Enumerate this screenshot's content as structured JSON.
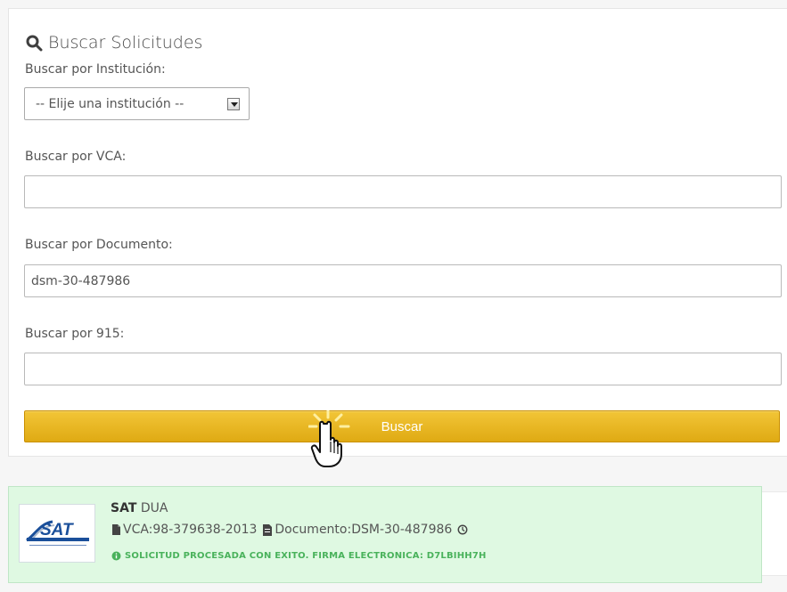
{
  "search": {
    "title": "Buscar Solicitudes",
    "institution_label": "Buscar por Institución:",
    "institution_selected": "-- Elije una institución --",
    "vca_label": "Buscar por VCA:",
    "vca_value": "",
    "document_label": "Buscar por Documento:",
    "document_value": "dsm-30-487986",
    "form915_label": "Buscar por 915:",
    "form915_value": "",
    "button_label": "Buscar"
  },
  "result": {
    "institution": "SAT",
    "type": "DUA",
    "vca_label": "VCA:98-379638-2013",
    "document_label": "Documento:DSM-30-487986",
    "status": "SOLICITUD PROCESADA CON EXITO. FIRMA ELECTRONICA: D7LBIHH7H",
    "logo_text": "SAT"
  },
  "icons": {
    "search": "search-icon",
    "dropdown": "chevron-down-icon",
    "file": "file-icon",
    "document": "document-icon",
    "clock": "clock-icon",
    "info": "info-icon",
    "cursor": "pointer-hand-icon"
  },
  "colors": {
    "button_top": "#f2c537",
    "button_bottom": "#dfaa13",
    "success_bg": "#dff9e2",
    "success_text": "#49b25b",
    "logo_blue": "#184f98"
  }
}
